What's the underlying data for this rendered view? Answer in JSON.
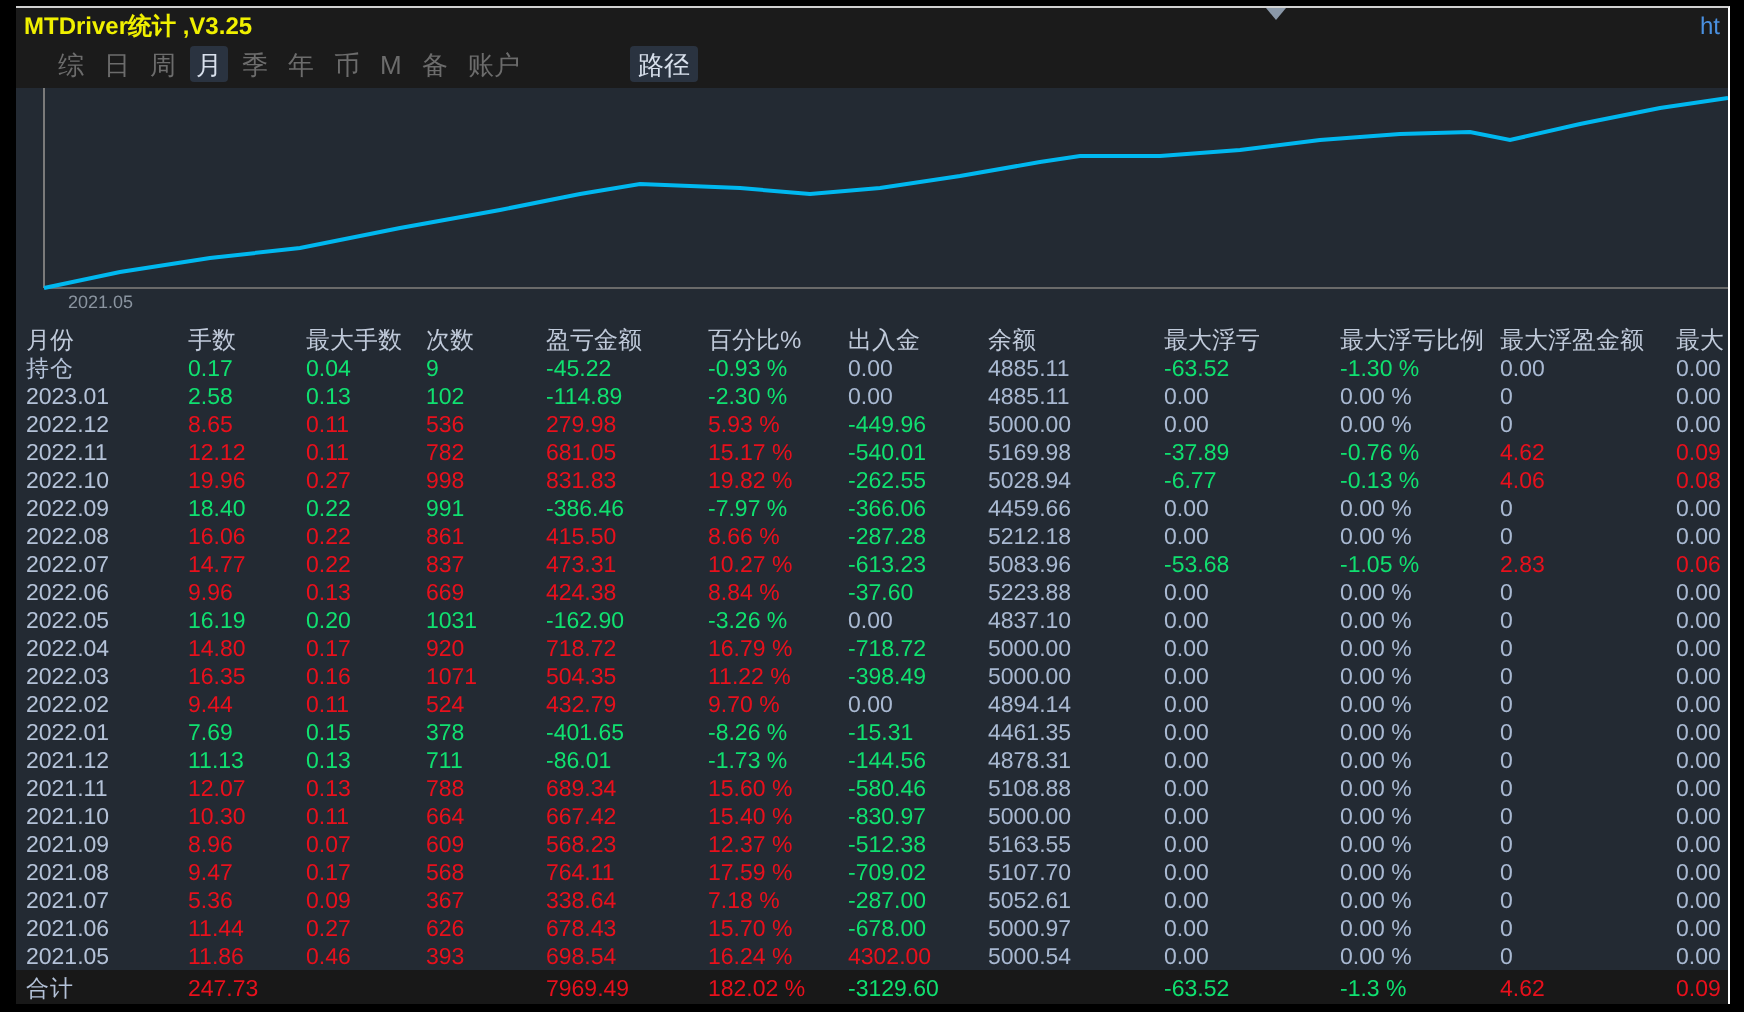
{
  "title": "MTDriver统计 ,V3.25",
  "link": "ht",
  "tabs": [
    {
      "label": "综",
      "selected": false
    },
    {
      "label": "日",
      "selected": false
    },
    {
      "label": "周",
      "selected": false
    },
    {
      "label": "月",
      "selected": true
    },
    {
      "label": "季",
      "selected": false
    },
    {
      "label": "年",
      "selected": false
    },
    {
      "label": "币",
      "selected": false
    },
    {
      "label": "M",
      "selected": false
    },
    {
      "label": "备",
      "selected": false
    },
    {
      "label": "账户",
      "selected": false
    }
  ],
  "path_button": "路径",
  "chart": {
    "start_label": "2021.05"
  },
  "table": {
    "columns": [
      "月份",
      "手数",
      "最大手数",
      "次数",
      "盈亏金额",
      "百分比%",
      "出入金",
      "余额",
      "最大浮亏",
      "最大浮亏比例",
      "最大浮盈金额",
      "最大"
    ],
    "rows": [
      {
        "cells": [
          {
            "text": "持仓",
            "color": "#b4c2d8"
          },
          {
            "text": "0.17",
            "color": "#10e070"
          },
          {
            "text": "0.04",
            "color": "#10e070"
          },
          {
            "text": "9",
            "color": "#10e070"
          },
          {
            "text": "-45.22",
            "color": "#10e070"
          },
          {
            "text": "-0.93 %",
            "color": "#10e070"
          },
          {
            "text": "0.00",
            "color": "#a9b9d2"
          },
          {
            "text": "4885.11",
            "color": "#a9b9d2"
          },
          {
            "text": "-63.52",
            "color": "#10e070"
          },
          {
            "text": "-1.30 %",
            "color": "#10e070"
          },
          {
            "text": "0.00",
            "color": "#a9b9d2"
          },
          {
            "text": "0.00",
            "color": "#a9b9d2"
          }
        ]
      },
      {
        "cells": [
          {
            "text": "2023.01",
            "color": "#b4c2d8"
          },
          {
            "text": "2.58",
            "color": "#10e070"
          },
          {
            "text": "0.13",
            "color": "#10e070"
          },
          {
            "text": "102",
            "color": "#10e070"
          },
          {
            "text": "-114.89",
            "color": "#10e070"
          },
          {
            "text": "-2.30 %",
            "color": "#10e070"
          },
          {
            "text": "0.00",
            "color": "#a9b9d2"
          },
          {
            "text": "4885.11",
            "color": "#a9b9d2"
          },
          {
            "text": "0.00",
            "color": "#a9b9d2"
          },
          {
            "text": "0.00 %",
            "color": "#a9b9d2"
          },
          {
            "text": "0",
            "color": "#a9b9d2"
          },
          {
            "text": "0.00",
            "color": "#a9b9d2"
          }
        ]
      },
      {
        "cells": [
          {
            "text": "2022.12",
            "color": "#b4c2d8"
          },
          {
            "text": "8.65",
            "color": "#e8101c"
          },
          {
            "text": "0.11",
            "color": "#e8101c"
          },
          {
            "text": "536",
            "color": "#e8101c"
          },
          {
            "text": "279.98",
            "color": "#e8101c"
          },
          {
            "text": "5.93 %",
            "color": "#e8101c"
          },
          {
            "text": "-449.96",
            "color": "#10e070"
          },
          {
            "text": "5000.00",
            "color": "#a9b9d2"
          },
          {
            "text": "0.00",
            "color": "#a9b9d2"
          },
          {
            "text": "0.00 %",
            "color": "#a9b9d2"
          },
          {
            "text": "0",
            "color": "#a9b9d2"
          },
          {
            "text": "0.00",
            "color": "#a9b9d2"
          }
        ]
      },
      {
        "cells": [
          {
            "text": "2022.11",
            "color": "#b4c2d8"
          },
          {
            "text": "12.12",
            "color": "#e8101c"
          },
          {
            "text": "0.11",
            "color": "#e8101c"
          },
          {
            "text": "782",
            "color": "#e8101c"
          },
          {
            "text": "681.05",
            "color": "#e8101c"
          },
          {
            "text": "15.17 %",
            "color": "#e8101c"
          },
          {
            "text": "-540.01",
            "color": "#10e070"
          },
          {
            "text": "5169.98",
            "color": "#a9b9d2"
          },
          {
            "text": "-37.89",
            "color": "#10e070"
          },
          {
            "text": "-0.76 %",
            "color": "#10e070"
          },
          {
            "text": "4.62",
            "color": "#e8101c"
          },
          {
            "text": "0.09",
            "color": "#e8101c"
          }
        ]
      },
      {
        "cells": [
          {
            "text": "2022.10",
            "color": "#b4c2d8"
          },
          {
            "text": "19.96",
            "color": "#e8101c"
          },
          {
            "text": "0.27",
            "color": "#e8101c"
          },
          {
            "text": "998",
            "color": "#e8101c"
          },
          {
            "text": "831.83",
            "color": "#e8101c"
          },
          {
            "text": "19.82 %",
            "color": "#e8101c"
          },
          {
            "text": "-262.55",
            "color": "#10e070"
          },
          {
            "text": "5028.94",
            "color": "#a9b9d2"
          },
          {
            "text": "-6.77",
            "color": "#10e070"
          },
          {
            "text": "-0.13 %",
            "color": "#10e070"
          },
          {
            "text": "4.06",
            "color": "#e8101c"
          },
          {
            "text": "0.08",
            "color": "#e8101c"
          }
        ]
      },
      {
        "cells": [
          {
            "text": "2022.09",
            "color": "#b4c2d8"
          },
          {
            "text": "18.40",
            "color": "#10e070"
          },
          {
            "text": "0.22",
            "color": "#10e070"
          },
          {
            "text": "991",
            "color": "#10e070"
          },
          {
            "text": "-386.46",
            "color": "#10e070"
          },
          {
            "text": "-7.97 %",
            "color": "#10e070"
          },
          {
            "text": "-366.06",
            "color": "#10e070"
          },
          {
            "text": "4459.66",
            "color": "#a9b9d2"
          },
          {
            "text": "0.00",
            "color": "#a9b9d2"
          },
          {
            "text": "0.00 %",
            "color": "#a9b9d2"
          },
          {
            "text": "0",
            "color": "#a9b9d2"
          },
          {
            "text": "0.00",
            "color": "#a9b9d2"
          }
        ]
      },
      {
        "cells": [
          {
            "text": "2022.08",
            "color": "#b4c2d8"
          },
          {
            "text": "16.06",
            "color": "#e8101c"
          },
          {
            "text": "0.22",
            "color": "#e8101c"
          },
          {
            "text": "861",
            "color": "#e8101c"
          },
          {
            "text": "415.50",
            "color": "#e8101c"
          },
          {
            "text": "8.66 %",
            "color": "#e8101c"
          },
          {
            "text": "-287.28",
            "color": "#10e070"
          },
          {
            "text": "5212.18",
            "color": "#a9b9d2"
          },
          {
            "text": "0.00",
            "color": "#a9b9d2"
          },
          {
            "text": "0.00 %",
            "color": "#a9b9d2"
          },
          {
            "text": "0",
            "color": "#a9b9d2"
          },
          {
            "text": "0.00",
            "color": "#a9b9d2"
          }
        ]
      },
      {
        "cells": [
          {
            "text": "2022.07",
            "color": "#b4c2d8"
          },
          {
            "text": "14.77",
            "color": "#e8101c"
          },
          {
            "text": "0.22",
            "color": "#e8101c"
          },
          {
            "text": "837",
            "color": "#e8101c"
          },
          {
            "text": "473.31",
            "color": "#e8101c"
          },
          {
            "text": "10.27 %",
            "color": "#e8101c"
          },
          {
            "text": "-613.23",
            "color": "#10e070"
          },
          {
            "text": "5083.96",
            "color": "#a9b9d2"
          },
          {
            "text": "-53.68",
            "color": "#10e070"
          },
          {
            "text": "-1.05 %",
            "color": "#10e070"
          },
          {
            "text": "2.83",
            "color": "#e8101c"
          },
          {
            "text": "0.06",
            "color": "#e8101c"
          }
        ]
      },
      {
        "cells": [
          {
            "text": "2022.06",
            "color": "#b4c2d8"
          },
          {
            "text": "9.96",
            "color": "#e8101c"
          },
          {
            "text": "0.13",
            "color": "#e8101c"
          },
          {
            "text": "669",
            "color": "#e8101c"
          },
          {
            "text": "424.38",
            "color": "#e8101c"
          },
          {
            "text": "8.84 %",
            "color": "#e8101c"
          },
          {
            "text": "-37.60",
            "color": "#10e070"
          },
          {
            "text": "5223.88",
            "color": "#a9b9d2"
          },
          {
            "text": "0.00",
            "color": "#a9b9d2"
          },
          {
            "text": "0.00 %",
            "color": "#a9b9d2"
          },
          {
            "text": "0",
            "color": "#a9b9d2"
          },
          {
            "text": "0.00",
            "color": "#a9b9d2"
          }
        ]
      },
      {
        "cells": [
          {
            "text": "2022.05",
            "color": "#b4c2d8"
          },
          {
            "text": "16.19",
            "color": "#10e070"
          },
          {
            "text": "0.20",
            "color": "#10e070"
          },
          {
            "text": "1031",
            "color": "#10e070"
          },
          {
            "text": "-162.90",
            "color": "#10e070"
          },
          {
            "text": "-3.26 %",
            "color": "#10e070"
          },
          {
            "text": "0.00",
            "color": "#a9b9d2"
          },
          {
            "text": "4837.10",
            "color": "#a9b9d2"
          },
          {
            "text": "0.00",
            "color": "#a9b9d2"
          },
          {
            "text": "0.00 %",
            "color": "#a9b9d2"
          },
          {
            "text": "0",
            "color": "#a9b9d2"
          },
          {
            "text": "0.00",
            "color": "#a9b9d2"
          }
        ]
      },
      {
        "cells": [
          {
            "text": "2022.04",
            "color": "#b4c2d8"
          },
          {
            "text": "14.80",
            "color": "#e8101c"
          },
          {
            "text": "0.17",
            "color": "#e8101c"
          },
          {
            "text": "920",
            "color": "#e8101c"
          },
          {
            "text": "718.72",
            "color": "#e8101c"
          },
          {
            "text": "16.79 %",
            "color": "#e8101c"
          },
          {
            "text": "-718.72",
            "color": "#10e070"
          },
          {
            "text": "5000.00",
            "color": "#a9b9d2"
          },
          {
            "text": "0.00",
            "color": "#a9b9d2"
          },
          {
            "text": "0.00 %",
            "color": "#a9b9d2"
          },
          {
            "text": "0",
            "color": "#a9b9d2"
          },
          {
            "text": "0.00",
            "color": "#a9b9d2"
          }
        ]
      },
      {
        "cells": [
          {
            "text": "2022.03",
            "color": "#b4c2d8"
          },
          {
            "text": "16.35",
            "color": "#e8101c"
          },
          {
            "text": "0.16",
            "color": "#e8101c"
          },
          {
            "text": "1071",
            "color": "#e8101c"
          },
          {
            "text": "504.35",
            "color": "#e8101c"
          },
          {
            "text": "11.22 %",
            "color": "#e8101c"
          },
          {
            "text": "-398.49",
            "color": "#10e070"
          },
          {
            "text": "5000.00",
            "color": "#a9b9d2"
          },
          {
            "text": "0.00",
            "color": "#a9b9d2"
          },
          {
            "text": "0.00 %",
            "color": "#a9b9d2"
          },
          {
            "text": "0",
            "color": "#a9b9d2"
          },
          {
            "text": "0.00",
            "color": "#a9b9d2"
          }
        ]
      },
      {
        "cells": [
          {
            "text": "2022.02",
            "color": "#b4c2d8"
          },
          {
            "text": "9.44",
            "color": "#e8101c"
          },
          {
            "text": "0.11",
            "color": "#e8101c"
          },
          {
            "text": "524",
            "color": "#e8101c"
          },
          {
            "text": "432.79",
            "color": "#e8101c"
          },
          {
            "text": "9.70 %",
            "color": "#e8101c"
          },
          {
            "text": "0.00",
            "color": "#a9b9d2"
          },
          {
            "text": "4894.14",
            "color": "#a9b9d2"
          },
          {
            "text": "0.00",
            "color": "#a9b9d2"
          },
          {
            "text": "0.00 %",
            "color": "#a9b9d2"
          },
          {
            "text": "0",
            "color": "#a9b9d2"
          },
          {
            "text": "0.00",
            "color": "#a9b9d2"
          }
        ]
      },
      {
        "cells": [
          {
            "text": "2022.01",
            "color": "#b4c2d8"
          },
          {
            "text": "7.69",
            "color": "#10e070"
          },
          {
            "text": "0.15",
            "color": "#10e070"
          },
          {
            "text": "378",
            "color": "#10e070"
          },
          {
            "text": "-401.65",
            "color": "#10e070"
          },
          {
            "text": "-8.26 %",
            "color": "#10e070"
          },
          {
            "text": "-15.31",
            "color": "#10e070"
          },
          {
            "text": "4461.35",
            "color": "#a9b9d2"
          },
          {
            "text": "0.00",
            "color": "#a9b9d2"
          },
          {
            "text": "0.00 %",
            "color": "#a9b9d2"
          },
          {
            "text": "0",
            "color": "#a9b9d2"
          },
          {
            "text": "0.00",
            "color": "#a9b9d2"
          }
        ]
      },
      {
        "cells": [
          {
            "text": "2021.12",
            "color": "#b4c2d8"
          },
          {
            "text": "11.13",
            "color": "#10e070"
          },
          {
            "text": "0.13",
            "color": "#10e070"
          },
          {
            "text": "711",
            "color": "#10e070"
          },
          {
            "text": "-86.01",
            "color": "#10e070"
          },
          {
            "text": "-1.73 %",
            "color": "#10e070"
          },
          {
            "text": "-144.56",
            "color": "#10e070"
          },
          {
            "text": "4878.31",
            "color": "#a9b9d2"
          },
          {
            "text": "0.00",
            "color": "#a9b9d2"
          },
          {
            "text": "0.00 %",
            "color": "#a9b9d2"
          },
          {
            "text": "0",
            "color": "#a9b9d2"
          },
          {
            "text": "0.00",
            "color": "#a9b9d2"
          }
        ]
      },
      {
        "cells": [
          {
            "text": "2021.11",
            "color": "#b4c2d8"
          },
          {
            "text": "12.07",
            "color": "#e8101c"
          },
          {
            "text": "0.13",
            "color": "#e8101c"
          },
          {
            "text": "788",
            "color": "#e8101c"
          },
          {
            "text": "689.34",
            "color": "#e8101c"
          },
          {
            "text": "15.60 %",
            "color": "#e8101c"
          },
          {
            "text": "-580.46",
            "color": "#10e070"
          },
          {
            "text": "5108.88",
            "color": "#a9b9d2"
          },
          {
            "text": "0.00",
            "color": "#a9b9d2"
          },
          {
            "text": "0.00 %",
            "color": "#a9b9d2"
          },
          {
            "text": "0",
            "color": "#a9b9d2"
          },
          {
            "text": "0.00",
            "color": "#a9b9d2"
          }
        ]
      },
      {
        "cells": [
          {
            "text": "2021.10",
            "color": "#b4c2d8"
          },
          {
            "text": "10.30",
            "color": "#e8101c"
          },
          {
            "text": "0.11",
            "color": "#e8101c"
          },
          {
            "text": "664",
            "color": "#e8101c"
          },
          {
            "text": "667.42",
            "color": "#e8101c"
          },
          {
            "text": "15.40 %",
            "color": "#e8101c"
          },
          {
            "text": "-830.97",
            "color": "#10e070"
          },
          {
            "text": "5000.00",
            "color": "#a9b9d2"
          },
          {
            "text": "0.00",
            "color": "#a9b9d2"
          },
          {
            "text": "0.00 %",
            "color": "#a9b9d2"
          },
          {
            "text": "0",
            "color": "#a9b9d2"
          },
          {
            "text": "0.00",
            "color": "#a9b9d2"
          }
        ]
      },
      {
        "cells": [
          {
            "text": "2021.09",
            "color": "#b4c2d8"
          },
          {
            "text": "8.96",
            "color": "#e8101c"
          },
          {
            "text": "0.07",
            "color": "#e8101c"
          },
          {
            "text": "609",
            "color": "#e8101c"
          },
          {
            "text": "568.23",
            "color": "#e8101c"
          },
          {
            "text": "12.37 %",
            "color": "#e8101c"
          },
          {
            "text": "-512.38",
            "color": "#10e070"
          },
          {
            "text": "5163.55",
            "color": "#a9b9d2"
          },
          {
            "text": "0.00",
            "color": "#a9b9d2"
          },
          {
            "text": "0.00 %",
            "color": "#a9b9d2"
          },
          {
            "text": "0",
            "color": "#a9b9d2"
          },
          {
            "text": "0.00",
            "color": "#a9b9d2"
          }
        ]
      },
      {
        "cells": [
          {
            "text": "2021.08",
            "color": "#b4c2d8"
          },
          {
            "text": "9.47",
            "color": "#e8101c"
          },
          {
            "text": "0.17",
            "color": "#e8101c"
          },
          {
            "text": "568",
            "color": "#e8101c"
          },
          {
            "text": "764.11",
            "color": "#e8101c"
          },
          {
            "text": "17.59 %",
            "color": "#e8101c"
          },
          {
            "text": "-709.02",
            "color": "#10e070"
          },
          {
            "text": "5107.70",
            "color": "#a9b9d2"
          },
          {
            "text": "0.00",
            "color": "#a9b9d2"
          },
          {
            "text": "0.00 %",
            "color": "#a9b9d2"
          },
          {
            "text": "0",
            "color": "#a9b9d2"
          },
          {
            "text": "0.00",
            "color": "#a9b9d2"
          }
        ]
      },
      {
        "cells": [
          {
            "text": "2021.07",
            "color": "#b4c2d8"
          },
          {
            "text": "5.36",
            "color": "#e8101c"
          },
          {
            "text": "0.09",
            "color": "#e8101c"
          },
          {
            "text": "367",
            "color": "#e8101c"
          },
          {
            "text": "338.64",
            "color": "#e8101c"
          },
          {
            "text": "7.18 %",
            "color": "#e8101c"
          },
          {
            "text": "-287.00",
            "color": "#10e070"
          },
          {
            "text": "5052.61",
            "color": "#a9b9d2"
          },
          {
            "text": "0.00",
            "color": "#a9b9d2"
          },
          {
            "text": "0.00 %",
            "color": "#a9b9d2"
          },
          {
            "text": "0",
            "color": "#a9b9d2"
          },
          {
            "text": "0.00",
            "color": "#a9b9d2"
          }
        ]
      },
      {
        "cells": [
          {
            "text": "2021.06",
            "color": "#b4c2d8"
          },
          {
            "text": "11.44",
            "color": "#e8101c"
          },
          {
            "text": "0.27",
            "color": "#e8101c"
          },
          {
            "text": "626",
            "color": "#e8101c"
          },
          {
            "text": "678.43",
            "color": "#e8101c"
          },
          {
            "text": "15.70 %",
            "color": "#e8101c"
          },
          {
            "text": "-678.00",
            "color": "#10e070"
          },
          {
            "text": "5000.97",
            "color": "#a9b9d2"
          },
          {
            "text": "0.00",
            "color": "#a9b9d2"
          },
          {
            "text": "0.00 %",
            "color": "#a9b9d2"
          },
          {
            "text": "0",
            "color": "#a9b9d2"
          },
          {
            "text": "0.00",
            "color": "#a9b9d2"
          }
        ]
      },
      {
        "cells": [
          {
            "text": "2021.05",
            "color": "#b4c2d8"
          },
          {
            "text": "11.86",
            "color": "#e8101c"
          },
          {
            "text": "0.46",
            "color": "#e8101c"
          },
          {
            "text": "393",
            "color": "#e8101c"
          },
          {
            "text": "698.54",
            "color": "#e8101c"
          },
          {
            "text": "16.24 %",
            "color": "#e8101c"
          },
          {
            "text": "4302.00",
            "color": "#e8101c"
          },
          {
            "text": "5000.54",
            "color": "#a9b9d2"
          },
          {
            "text": "0.00",
            "color": "#a9b9d2"
          },
          {
            "text": "0.00 %",
            "color": "#a9b9d2"
          },
          {
            "text": "0",
            "color": "#a9b9d2"
          },
          {
            "text": "0.00",
            "color": "#a9b9d2"
          }
        ]
      }
    ],
    "total": {
      "label": {
        "text": "合计",
        "color": "#b4c2d8"
      },
      "lots": {
        "text": "247.73",
        "color": "#e8101c"
      },
      "profit": {
        "text": "7969.49",
        "color": "#e8101c"
      },
      "percent": {
        "text": "182.02 %",
        "color": "#e8101c"
      },
      "deposit": {
        "text": "-3129.60",
        "color": "#10e070"
      },
      "max_float_loss": {
        "text": "-63.52",
        "color": "#10e070"
      },
      "max_float_loss_ratio": {
        "text": "-1.3 %",
        "color": "#10e070"
      },
      "max_float_profit": {
        "text": "4.62",
        "color": "#e8101c"
      },
      "column_12": {
        "text": "0.09",
        "color": "#e8101c"
      }
    }
  }
}
